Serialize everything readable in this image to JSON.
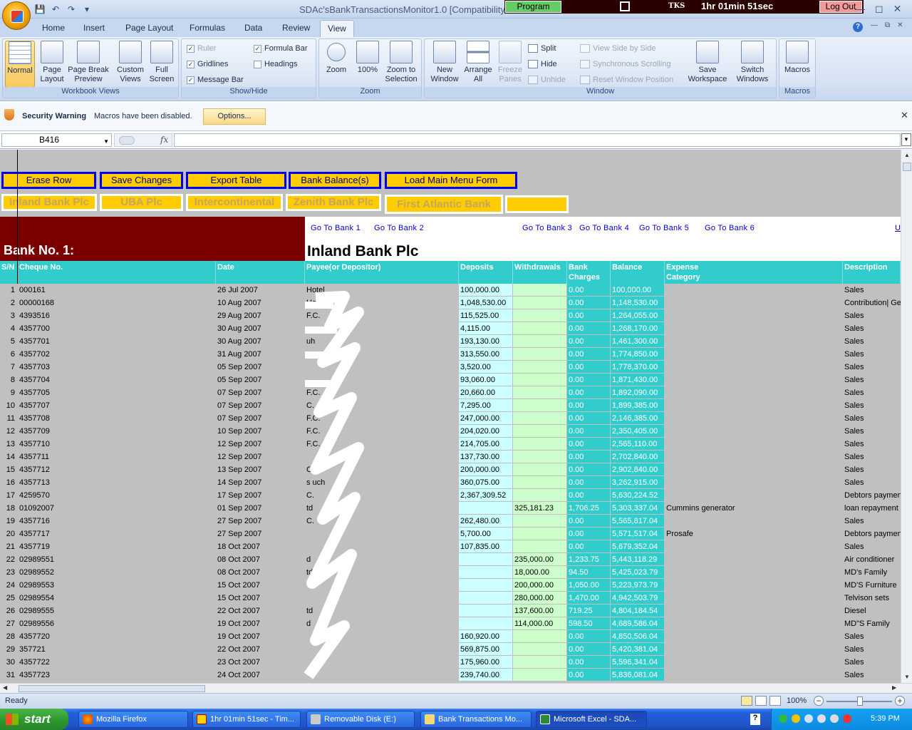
{
  "window": {
    "doc_title": "SDAc'sBankTransactionsMonitor1.0  [Compatibility",
    "program_label": "Program",
    "tks_label": "TKS",
    "timer": "1hr 01min 51sec",
    "logout_label": "Log Out"
  },
  "tabs": [
    "Home",
    "Insert",
    "Page Layout",
    "Formulas",
    "Data",
    "Review",
    "View"
  ],
  "ribbon": {
    "workbook_views": {
      "label": "Workbook Views",
      "buttons": [
        "Normal",
        "Page\nLayout",
        "Page Break\nPreview",
        "Custom\nViews",
        "Full\nScreen"
      ]
    },
    "show_hide": {
      "label": "Show/Hide",
      "items": [
        {
          "label": "Ruler",
          "checked": true,
          "disabled": true
        },
        {
          "label": "Formula Bar",
          "checked": true
        },
        {
          "label": "Gridlines",
          "checked": true
        },
        {
          "label": "Headings",
          "checked": false
        },
        {
          "label": "Message Bar",
          "checked": true
        }
      ]
    },
    "zoom": {
      "label": "Zoom",
      "buttons": [
        "Zoom",
        "100%",
        "Zoom to\nSelection"
      ]
    },
    "window": {
      "label": "Window",
      "buttons": [
        "New\nWindow",
        "Arrange\nAll",
        "Freeze\nPanes"
      ],
      "small": [
        "Split",
        "Hide",
        "Unhide",
        "View Side by Side",
        "Synchronous Scrolling",
        "Reset Window Position"
      ],
      "workspace": [
        "Save\nWorkspace",
        "Switch\nWindows"
      ]
    },
    "macros": {
      "label": "Macros",
      "button": "Macros"
    }
  },
  "security": {
    "title": "Security Warning",
    "message": "Macros have been disabled.",
    "options": "Options..."
  },
  "formula_bar": {
    "name_box": "B416",
    "fx": "fx",
    "content": ""
  },
  "sheet": {
    "macro_buttons": [
      "Erase Row",
      "Save Changes",
      "Export Table",
      "Bank Balance(s)",
      "Load Main Menu Form"
    ],
    "bank_buttons": [
      "Inland Bank Plc",
      "UBA Plc",
      "Intercontinental",
      "Zenith Bank Plc",
      "First Atlantic Bank",
      ""
    ],
    "bank_no": "Bank No. 1:",
    "bank_name": "Inland Bank Plc",
    "goto_links": [
      "Go To Bank 1",
      "Go To Bank 2",
      "Go To Bank 3",
      "Go To Bank 4",
      "Go To Bank 5",
      "Go To Bank 6",
      "U"
    ],
    "columns": [
      "S/N",
      "Cheque No.",
      "Date",
      "Payee(or Depositor)",
      "Deposits",
      "Withdrawals",
      "Bank\nCharges",
      "Balance",
      "Expense\nCategory",
      "Description"
    ],
    "rows": [
      [
        "1",
        "000161",
        "26 Jul 2007",
        "Hotel",
        "100,000.00",
        "",
        "0.00",
        "100,000.00",
        "",
        "Sales"
      ],
      [
        "2",
        "00000168",
        "10 Aug 2007",
        "Hotel",
        "1,048,530.00",
        "",
        "0.00",
        "1,148,530.00",
        "",
        "Contribution| Ger"
      ],
      [
        "3",
        "4393516",
        "29 Aug 2007",
        "F.C.",
        "115,525.00",
        "",
        "0.00",
        "1,264,055.00",
        "",
        "Sales"
      ],
      [
        "4",
        "4357700",
        "30 Aug 2007",
        "",
        "4,115.00",
        "",
        "0.00",
        "1,268,170.00",
        "",
        "Sales"
      ],
      [
        "5",
        "4357701",
        "30 Aug 2007",
        "uh",
        "193,130.00",
        "",
        "0.00",
        "1,461,300.00",
        "",
        "Sales"
      ],
      [
        "6",
        "4357702",
        "31 Aug 2007",
        "",
        "313,550.00",
        "",
        "0.00",
        "1,774,850.00",
        "",
        "Sales"
      ],
      [
        "7",
        "4357703",
        "05 Sep 2007",
        "",
        "3,520.00",
        "",
        "0.00",
        "1,778,370.00",
        "",
        "Sales"
      ],
      [
        "8",
        "4357704",
        "05 Sep 2007",
        "",
        "93,060.00",
        "",
        "0.00",
        "1,871,430.00",
        "",
        "Sales"
      ],
      [
        "9",
        "4357705",
        "07 Sep 2007",
        "F.C.",
        "20,660.00",
        "",
        "0.00",
        "1,892,090.00",
        "",
        "Sales"
      ],
      [
        "10",
        "4357707",
        "07 Sep 2007",
        "C.",
        "7,295.00",
        "",
        "0.00",
        "1,899,385.00",
        "",
        "Sales"
      ],
      [
        "11",
        "4357708",
        "07 Sep 2007",
        "F.C.",
        "247,000.00",
        "",
        "0.00",
        "2,146,385.00",
        "",
        "Sales"
      ],
      [
        "12",
        "4357709",
        "10 Sep 2007",
        "F.C.",
        "204,020.00",
        "",
        "0.00",
        "2,350,405.00",
        "",
        "Sales"
      ],
      [
        "13",
        "4357710",
        "12 Sep 2007",
        "F.C.",
        "214,705.00",
        "",
        "0.00",
        "2,565,110.00",
        "",
        "Sales"
      ],
      [
        "14",
        "4357711",
        "12 Sep 2007",
        "",
        "137,730.00",
        "",
        "0.00",
        "2,702,840.00",
        "",
        "Sales"
      ],
      [
        "15",
        "4357712",
        "13 Sep 2007",
        "C.",
        "200,000.00",
        "",
        "0.00",
        "2,902,840.00",
        "",
        "Sales"
      ],
      [
        "16",
        "4357713",
        "14 Sep 2007",
        "s   uch",
        "360,075.00",
        "",
        "0.00",
        "3,262,915.00",
        "",
        "Sales"
      ],
      [
        "17",
        "4259570",
        "17 Sep 2007",
        "C.",
        "2,367,309.52",
        "",
        "0.00",
        "5,630,224.52",
        "",
        "Debtors paymen"
      ],
      [
        "18",
        "01092007",
        "01 Sep 2007",
        "td",
        "",
        "325,181.23",
        "1,706.25",
        "5,303,337.04",
        "Cummins generator",
        "loan repayment"
      ],
      [
        "19",
        "4357716",
        "27 Sep 2007",
        "C.",
        "262,480.00",
        "",
        "0.00",
        "5,565,817.04",
        "",
        "Sales"
      ],
      [
        "20",
        "4357717",
        "27 Sep 2007",
        "",
        "5,700.00",
        "",
        "0.00",
        "5,571,517.04",
        "Prosafe",
        "Debtors paymen"
      ],
      [
        "21",
        "4357719",
        "18 Oct 2007",
        "",
        "107,835.00",
        "",
        "0.00",
        "5,679,352.04",
        "",
        "Sales"
      ],
      [
        "22",
        "02989551",
        "08 Oct 2007",
        "d",
        "",
        "235,000.00",
        "1,233.75",
        "5,443,118.29",
        "",
        "Air conditioner"
      ],
      [
        "23",
        "02989552",
        "08 Oct 2007",
        "td",
        "",
        "18,000.00",
        "94.50",
        "5,425,023.79",
        "",
        "MD's Family"
      ],
      [
        "24",
        "02989553",
        "15 Oct 2007",
        "",
        "",
        "200,000.00",
        "1,050.00",
        "5,223,973.79",
        "",
        "MD'S Furniture"
      ],
      [
        "25",
        "02989554",
        "15 Oct 2007",
        "",
        "",
        "280,000.00",
        "1,470.00",
        "4,942,503.79",
        "",
        "Telvison sets"
      ],
      [
        "26",
        "02989555",
        "22 Oct 2007",
        "td",
        "",
        "137,600.00",
        "719.25",
        "4,804,184.54",
        "",
        "Diesel"
      ],
      [
        "27",
        "02989556",
        "19 Oct 2007",
        "d",
        "",
        "114,000.00",
        "598.50",
        "4,689,586.04",
        "",
        "MD\"S Family"
      ],
      [
        "28",
        "4357720",
        "19 Oct 2007",
        "",
        "160,920.00",
        "",
        "0.00",
        "4,850,506.04",
        "",
        "Sales"
      ],
      [
        "29",
        "357721",
        "22 Oct 2007",
        "",
        "569,875.00",
        "",
        "0.00",
        "5,420,381.04",
        "",
        "Sales"
      ],
      [
        "30",
        "4357722",
        "23 Oct 2007",
        "",
        "175,960.00",
        "",
        "0.00",
        "5,596,341.04",
        "",
        "Sales"
      ],
      [
        "31",
        "4357723",
        "24 Oct 2007",
        "",
        "239,740.00",
        "",
        "0.00",
        "5,836,081.04",
        "",
        "Sales"
      ]
    ]
  },
  "status": {
    "ready": "Ready",
    "zoom": "100%"
  },
  "taskbar": {
    "start": "start",
    "tasks": [
      "Mozilla Firefox",
      "1hr 01min 51sec - Tim...",
      "Removable Disk (E:)",
      "Bank Transactions Mo...",
      "Microsoft Excel - SDA..."
    ],
    "clock": "5:39 PM"
  },
  "colors": {
    "maroon": "#7b0000",
    "teal": "#33cccc",
    "gold": "#ffcc00",
    "blue_border": "#0000ee"
  }
}
